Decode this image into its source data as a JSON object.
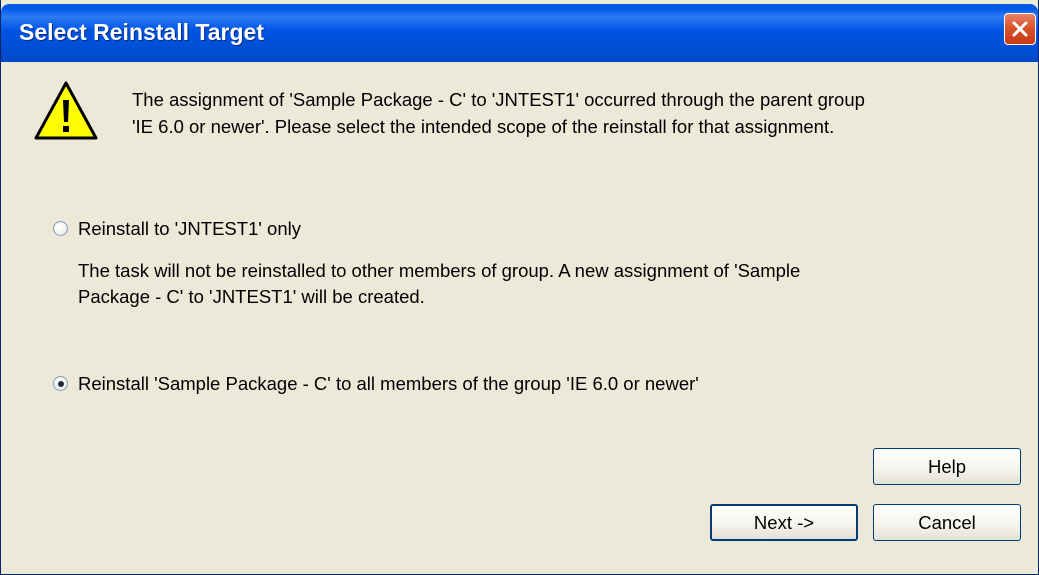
{
  "window": {
    "title": "Select Reinstall Target"
  },
  "message": {
    "line1": "The assignment of 'Sample Package - C' to 'JNTEST1' occurred through the parent group",
    "line2": "'IE 6.0 or newer'. Please select the intended scope of the reinstall for that assignment."
  },
  "options": [
    {
      "label": "Reinstall to 'JNTEST1' only",
      "description_line1": "The task will not be reinstalled to other members of group. A new assignment of 'Sample",
      "description_line2": "Package - C' to 'JNTEST1' will be created.",
      "selected": false
    },
    {
      "label": "Reinstall 'Sample Package - C' to all members of the group 'IE 6.0 or newer'",
      "selected": true
    }
  ],
  "buttons": {
    "help": "Help",
    "next": "Next ->",
    "cancel": "Cancel"
  },
  "icons": {
    "close": "close-icon",
    "warning": "warning-icon"
  },
  "colors": {
    "titlebar": "#0054e3",
    "dialog_background": "#ece9d8",
    "close_button": "#d9532c",
    "warning_yellow": "#ffff00"
  }
}
